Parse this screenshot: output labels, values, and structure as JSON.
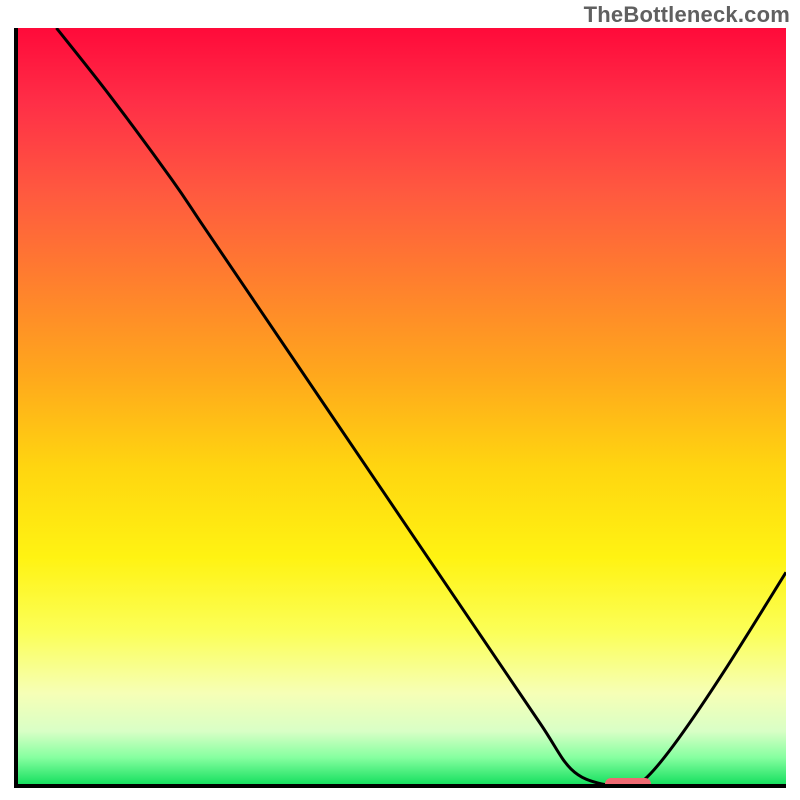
{
  "watermark": "TheBottleneck.com",
  "colors": {
    "curve_stroke": "#000000",
    "marker_fill": "#ef6a72",
    "axis_stroke": "#000000"
  },
  "chart_data": {
    "type": "line",
    "title": "",
    "xlabel": "",
    "ylabel": "",
    "xlim": [
      0,
      100
    ],
    "ylim": [
      0,
      100
    ],
    "grid": false,
    "legend": false,
    "note": "Axes carry no numeric tick labels in the source image; x/y values below are estimates read from curve position relative to plot area (percent of each axis).",
    "series": [
      {
        "name": "bottleneck-curve",
        "x": [
          5,
          12,
          20,
          24,
          30,
          40,
          50,
          60,
          68,
          72,
          76,
          80,
          82,
          86,
          92,
          100
        ],
        "y": [
          100,
          91,
          80,
          74,
          65,
          50,
          35,
          20,
          8,
          2,
          0,
          0,
          1,
          6,
          15,
          28
        ]
      }
    ],
    "marker": {
      "x_start": 76,
      "x_end": 82,
      "y": 0.5,
      "description": "short horizontal pink/red bar near curve minimum on x-axis"
    },
    "background_gradient": {
      "orientation": "vertical",
      "stops": [
        {
          "pos": 0.0,
          "color": "#ff0a3a"
        },
        {
          "pos": 0.1,
          "color": "#ff2f47"
        },
        {
          "pos": 0.22,
          "color": "#ff5a3f"
        },
        {
          "pos": 0.32,
          "color": "#ff7a30"
        },
        {
          "pos": 0.46,
          "color": "#ffa81c"
        },
        {
          "pos": 0.58,
          "color": "#ffd510"
        },
        {
          "pos": 0.7,
          "color": "#fff312"
        },
        {
          "pos": 0.8,
          "color": "#fbff59"
        },
        {
          "pos": 0.88,
          "color": "#f6ffb6"
        },
        {
          "pos": 0.93,
          "color": "#d9ffc6"
        },
        {
          "pos": 0.965,
          "color": "#86ffa0"
        },
        {
          "pos": 1.0,
          "color": "#18e060"
        }
      ]
    }
  }
}
